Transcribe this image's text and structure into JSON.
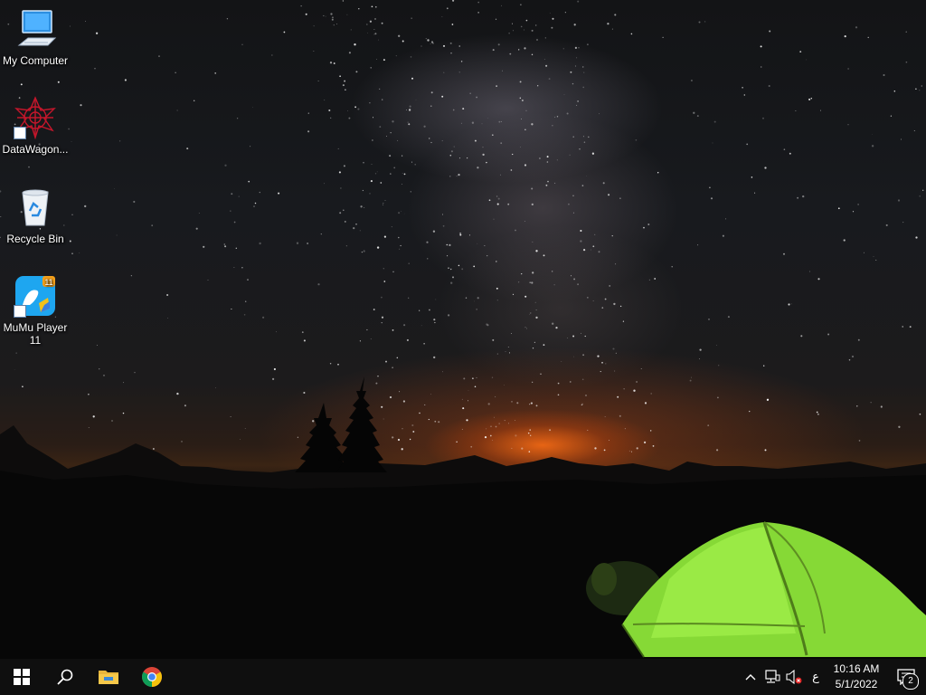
{
  "desktop_icons": [
    {
      "label": "My Computer",
      "icon": "computer-icon"
    },
    {
      "label": "DataWagon...",
      "icon": "datawagon-icon",
      "shortcut": true
    },
    {
      "label": "Recycle Bin",
      "icon": "recycle-bin-icon"
    },
    {
      "label": "MuMu Player 11",
      "icon": "mumu-player-icon",
      "shortcut": true
    }
  ],
  "taskbar": {
    "pinned": [
      {
        "name": "start",
        "icon": "windows-logo-icon"
      },
      {
        "name": "search",
        "icon": "search-icon"
      },
      {
        "name": "file-explorer",
        "icon": "folder-icon"
      },
      {
        "name": "chrome",
        "icon": "chrome-icon"
      }
    ],
    "tray": {
      "language": "ع",
      "time": "10:16 AM",
      "date": "5/1/2022",
      "notification_count": "2"
    }
  },
  "colors": {
    "taskbar_bg": "#101010",
    "tent_green": "#8fe23a",
    "horizon_orange": "#ff6e14"
  }
}
